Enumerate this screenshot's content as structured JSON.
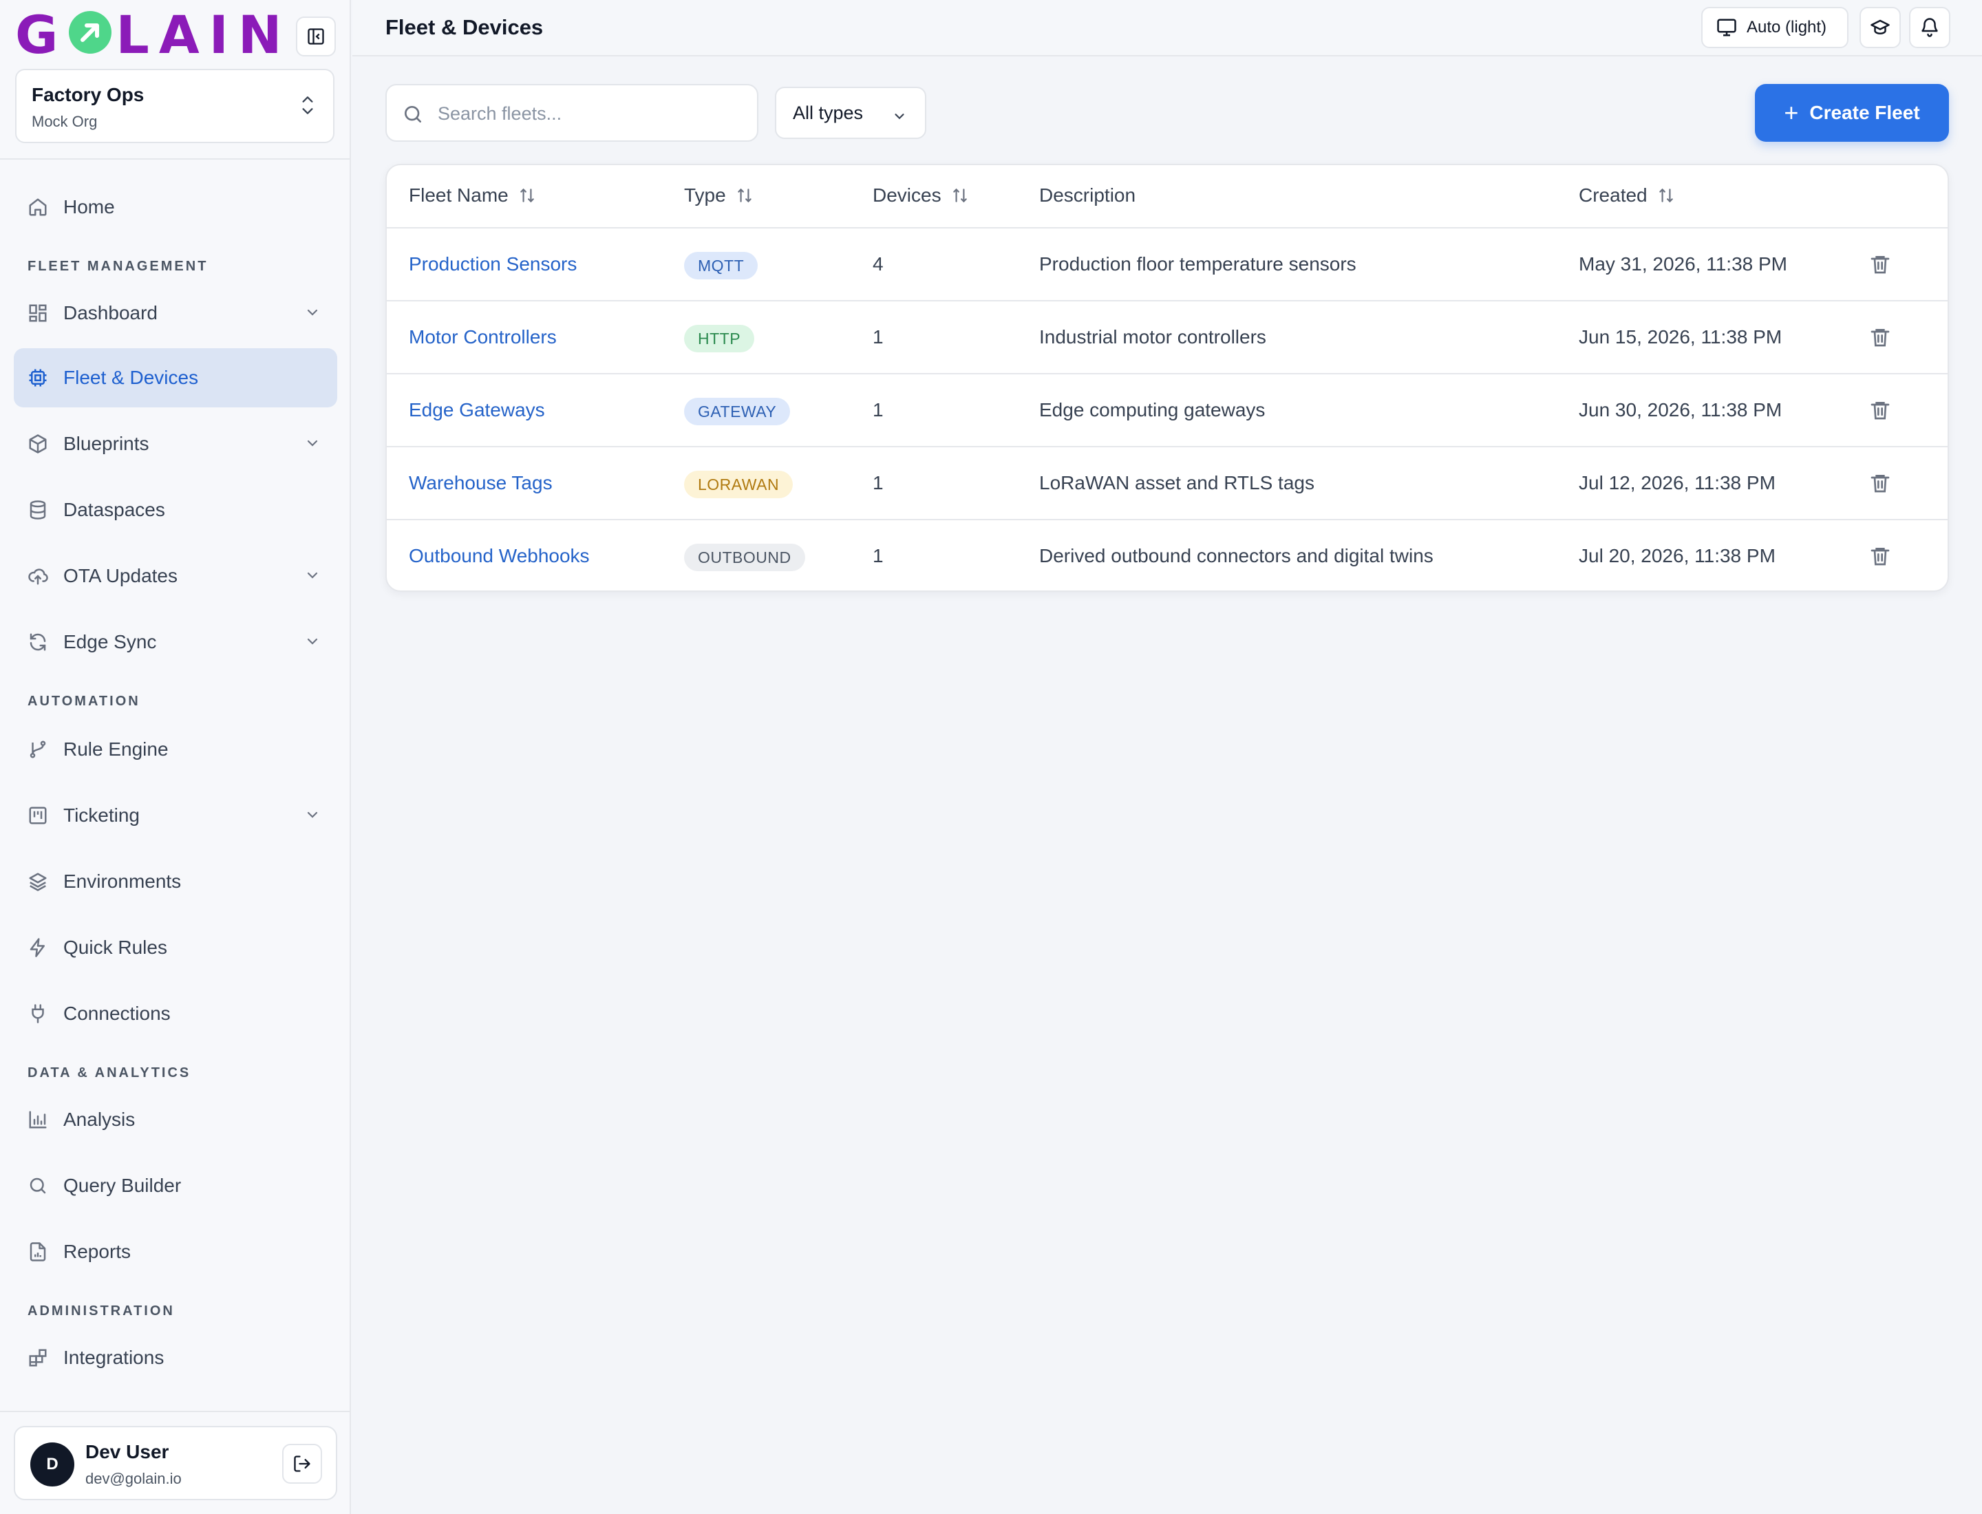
{
  "brand": {
    "logo_text_left": "G",
    "logo_text_right": "LAIN"
  },
  "org": {
    "name": "Factory Ops",
    "subtitle": "Mock Org"
  },
  "nav": {
    "home": "Home",
    "sections": {
      "fleet_management": "FLEET MANAGEMENT",
      "automation": "AUTOMATION",
      "data_analytics": "DATA & ANALYTICS",
      "administration": "ADMINISTRATION"
    },
    "items": {
      "dashboard": "Dashboard",
      "fleet_devices": "Fleet & Devices",
      "blueprints": "Blueprints",
      "dataspaces": "Dataspaces",
      "ota_updates": "OTA Updates",
      "edge_sync": "Edge Sync",
      "rule_engine": "Rule Engine",
      "ticketing": "Ticketing",
      "environments": "Environments",
      "quick_rules": "Quick Rules",
      "connections": "Connections",
      "analysis": "Analysis",
      "query_builder": "Query Builder",
      "reports": "Reports",
      "integrations": "Integrations"
    }
  },
  "user": {
    "initial": "D",
    "name": "Dev User",
    "email": "dev@golain.io"
  },
  "header": {
    "title": "Fleet & Devices",
    "theme_label": "Auto (light)"
  },
  "toolbar": {
    "search_placeholder": "Search fleets...",
    "type_filter": "All types",
    "create_label": "Create Fleet"
  },
  "table": {
    "columns": {
      "name": "Fleet Name",
      "type": "Type",
      "devices": "Devices",
      "description": "Description",
      "created": "Created"
    },
    "rows": [
      {
        "name": "Production Sensors",
        "type": "MQTT",
        "devices": "4",
        "description": "Production floor temperature sensors",
        "created": "May 31, 2026, 11:38 PM"
      },
      {
        "name": "Motor Controllers",
        "type": "HTTP",
        "devices": "1",
        "description": "Industrial motor controllers",
        "created": "Jun 15, 2026, 11:38 PM"
      },
      {
        "name": "Edge Gateways",
        "type": "GATEWAY",
        "devices": "1",
        "description": "Edge computing gateways",
        "created": "Jun 30, 2026, 11:38 PM"
      },
      {
        "name": "Warehouse Tags",
        "type": "LORAWAN",
        "devices": "1",
        "description": "LoRaWAN asset and RTLS tags",
        "created": "Jul 12, 2026, 11:38 PM"
      },
      {
        "name": "Outbound Webhooks",
        "type": "OUTBOUND",
        "devices": "1",
        "description": "Derived outbound connectors and digital twins",
        "created": "Jul 20, 2026, 11:38 PM"
      }
    ]
  },
  "colors": {
    "accent": "#2b72e6",
    "brand_purple": "#8b1bb8",
    "brand_green": "#4fd68a",
    "badge_mqtt": "#dde8fb",
    "badge_http": "#dcf5e4",
    "badge_gateway": "#dde8fb",
    "badge_lorawan": "#fdf3d6",
    "badge_outbound": "#eceef1"
  }
}
